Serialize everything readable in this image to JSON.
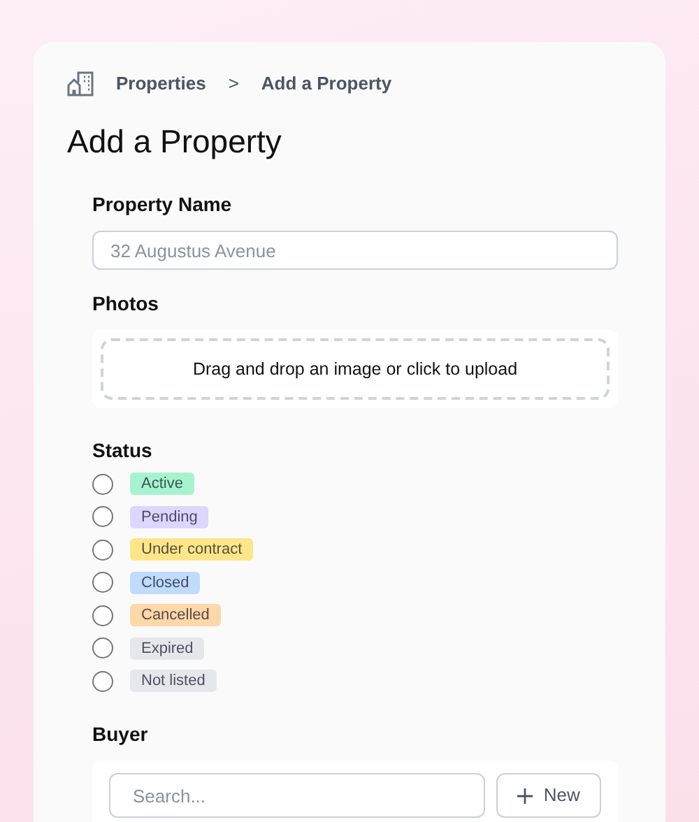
{
  "breadcrumb": {
    "items": [
      "Properties",
      "Add a Property"
    ],
    "separator": ">"
  },
  "title": "Add a Property",
  "property_name": {
    "label": "Property Name",
    "placeholder": "32 Augustus Avenue"
  },
  "photos": {
    "label": "Photos",
    "dropzone_text": "Drag and drop an image or click to upload"
  },
  "status": {
    "label": "Status",
    "options": [
      {
        "label": "Active",
        "color": "#a7f3d0",
        "selected": false
      },
      {
        "label": "Pending",
        "color": "#ddd6fe",
        "selected": false
      },
      {
        "label": "Under contract",
        "color": "#fde68a",
        "selected": false
      },
      {
        "label": "Closed",
        "color": "#bfdbfe",
        "selected": false
      },
      {
        "label": "Cancelled",
        "color": "#fed7aa",
        "selected": false
      },
      {
        "label": "Expired",
        "color": "#e5e7eb",
        "selected": false
      },
      {
        "label": "Not listed",
        "color": "#e5e7eb",
        "selected": false
      }
    ]
  },
  "buyer": {
    "label": "Buyer",
    "search_placeholder": "Search...",
    "new_button": "New"
  }
}
